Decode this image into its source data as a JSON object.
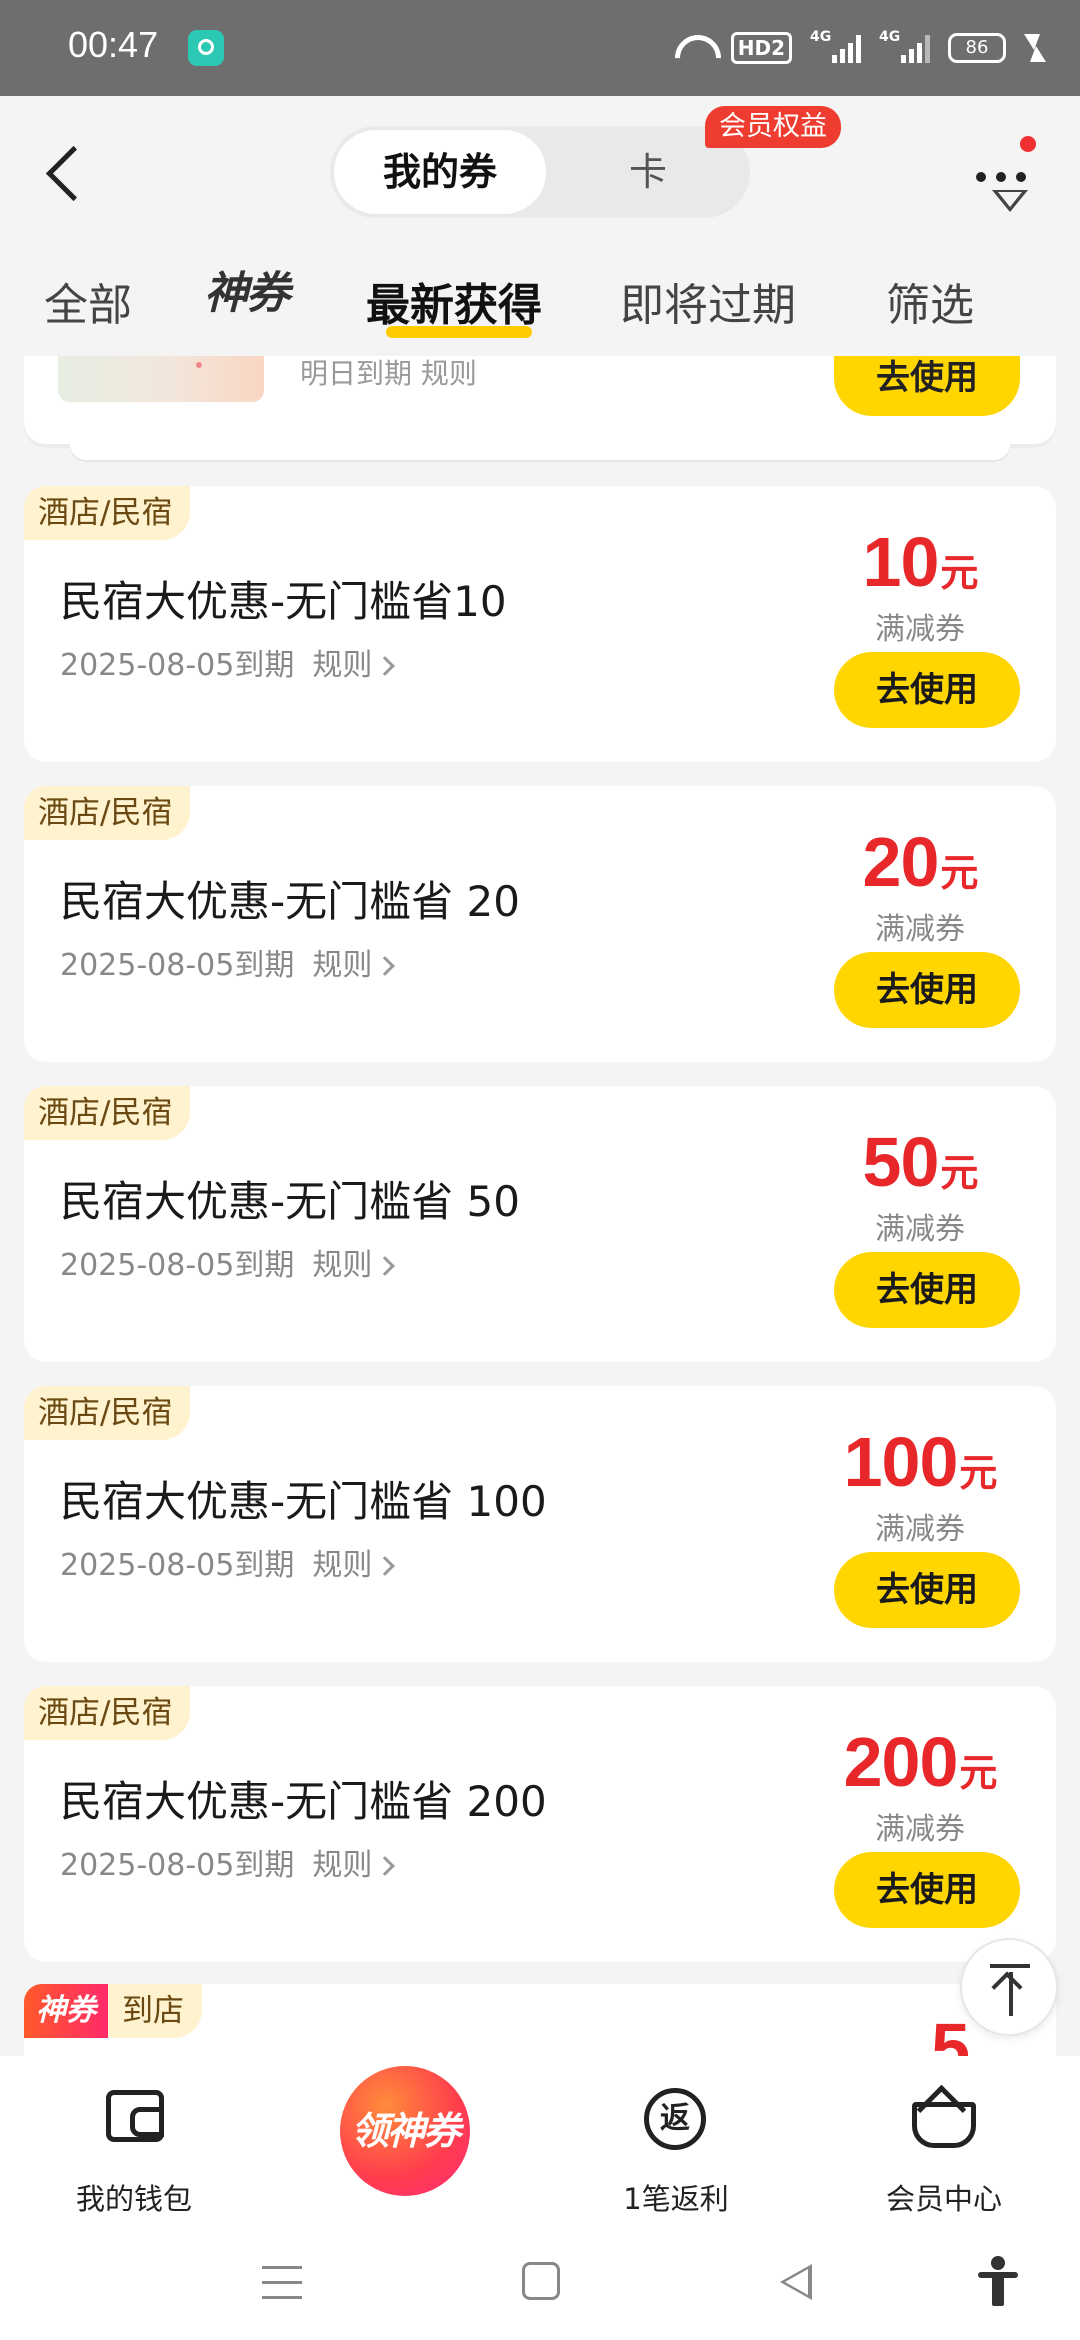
{
  "status_bar": {
    "time": "00:47",
    "hd": "HD2",
    "net1": "4G",
    "net2": "4G",
    "battery": "86"
  },
  "header": {
    "segment_active": "我的券",
    "segment_inactive": "卡",
    "member_badge": "会员权益"
  },
  "tabs": [
    {
      "label": "全部"
    },
    {
      "label": "神券"
    },
    {
      "label": "最新获得"
    },
    {
      "label": "即将过期"
    },
    {
      "label": "筛选"
    }
  ],
  "partial_card": {
    "meta": "明日到期   规则",
    "button": "去使用"
  },
  "coupons": [
    {
      "tag": "酒店/民宿",
      "title": "民宿大优惠-无门槛省10",
      "expiry": "2025-08-05到期",
      "rules": "规则",
      "amount": "10",
      "unit": "元",
      "type": "满减券",
      "button": "去使用"
    },
    {
      "tag": "酒店/民宿",
      "title": "民宿大优惠-无门槛省 20",
      "expiry": "2025-08-05到期",
      "rules": "规则",
      "amount": "20",
      "unit": "元",
      "type": "满减券",
      "button": "去使用"
    },
    {
      "tag": "酒店/民宿",
      "title": "民宿大优惠-无门槛省 50",
      "expiry": "2025-08-05到期",
      "rules": "规则",
      "amount": "50",
      "unit": "元",
      "type": "满减券",
      "button": "去使用"
    },
    {
      "tag": "酒店/民宿",
      "title": "民宿大优惠-无门槛省 100",
      "expiry": "2025-08-05到期",
      "rules": "规则",
      "amount": "100",
      "unit": "元",
      "type": "满减券",
      "button": "去使用"
    },
    {
      "tag": "酒店/民宿",
      "title": "民宿大优惠-无门槛省 200",
      "expiry": "2025-08-05到期",
      "rules": "规则",
      "amount": "200",
      "unit": "元",
      "type": "满减券",
      "button": "去使用"
    }
  ],
  "bottom_card": {
    "brand_tag": "神券",
    "store_tag": "到店",
    "amount_peek": "5"
  },
  "bottom_nav": {
    "wallet": "我的钱包",
    "center": "领神券",
    "rebate_icon": "返",
    "rebate": "1笔返利",
    "vip": "会员中心"
  },
  "colors": {
    "accent_yellow": "#ffd600",
    "price_red": "#e8272a",
    "badge_red": "#ee3c30"
  }
}
